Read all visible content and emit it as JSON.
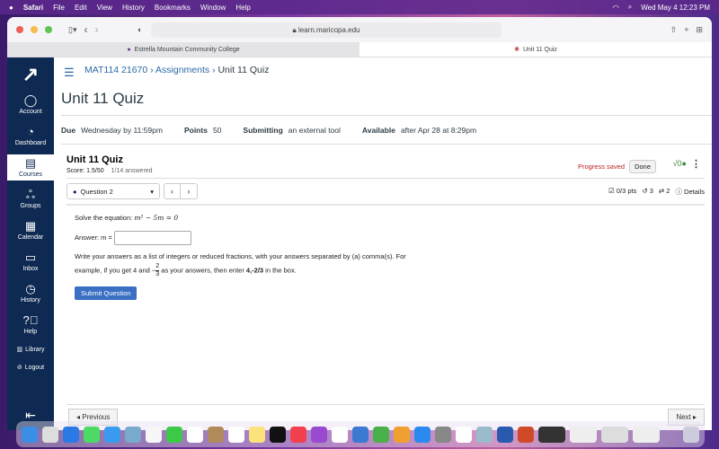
{
  "menubar": {
    "app": "Safari",
    "items": [
      "File",
      "Edit",
      "View",
      "History",
      "Bookmarks",
      "Window",
      "Help"
    ],
    "clock": "Wed May 4  12:23 PM"
  },
  "browser": {
    "url": "learn.maricopa.edu",
    "tabs": [
      {
        "label": "Estrella Mountain Community College"
      },
      {
        "label": "Unit 11 Quiz"
      }
    ]
  },
  "sidebar": {
    "items": [
      {
        "label": "Account",
        "icon": "account-icon"
      },
      {
        "label": "Dashboard",
        "icon": "dashboard-icon"
      },
      {
        "label": "Courses",
        "icon": "courses-icon"
      },
      {
        "label": "Groups",
        "icon": "groups-icon"
      },
      {
        "label": "Calendar",
        "icon": "calendar-icon"
      },
      {
        "label": "Inbox",
        "icon": "inbox-icon"
      },
      {
        "label": "History",
        "icon": "history-icon"
      },
      {
        "label": "Help",
        "icon": "help-icon"
      },
      {
        "label": "Library",
        "icon": "library-icon"
      },
      {
        "label": "Logout",
        "icon": "logout-icon"
      }
    ]
  },
  "breadcrumb": {
    "course": "MAT114 21670",
    "section": "Assignments",
    "current": "Unit 11 Quiz"
  },
  "page_title": "Unit 11 Quiz",
  "details": {
    "due_label": "Due",
    "due": "Wednesday by 11:59pm",
    "points_label": "Points",
    "points": "50",
    "submitting_label": "Submitting",
    "submitting": "an external tool",
    "available_label": "Available",
    "available": "after Apr 28 at 8:29pm"
  },
  "quiz": {
    "title": "Unit 11 Quiz",
    "score": "Score: 1.5/50",
    "answered": "1/14 answered",
    "progress": "Progress saved",
    "done": "Done",
    "question": "Question 2",
    "pts": "0/3 pts",
    "retries": "3",
    "attempts": "2",
    "details": "Details",
    "prompt": "Solve the equation: ",
    "equation": "m² − 5m = 0",
    "answer_label": "Answer: m =",
    "answer_value": "",
    "instr1": "Write your answers as a list of integers or reduced fractions, with your answers separated by (a) comma(s). For",
    "instr2a": "example, if you get 4 and −",
    "frac_num": "2",
    "frac_den": "3",
    "instr2b": " as your answers, then enter ",
    "example": "4,-2/3",
    "instr2c": " in the box.",
    "submit": "Submit Question"
  },
  "footer": {
    "previous": "◂ Previous",
    "next": "Next ▸"
  }
}
